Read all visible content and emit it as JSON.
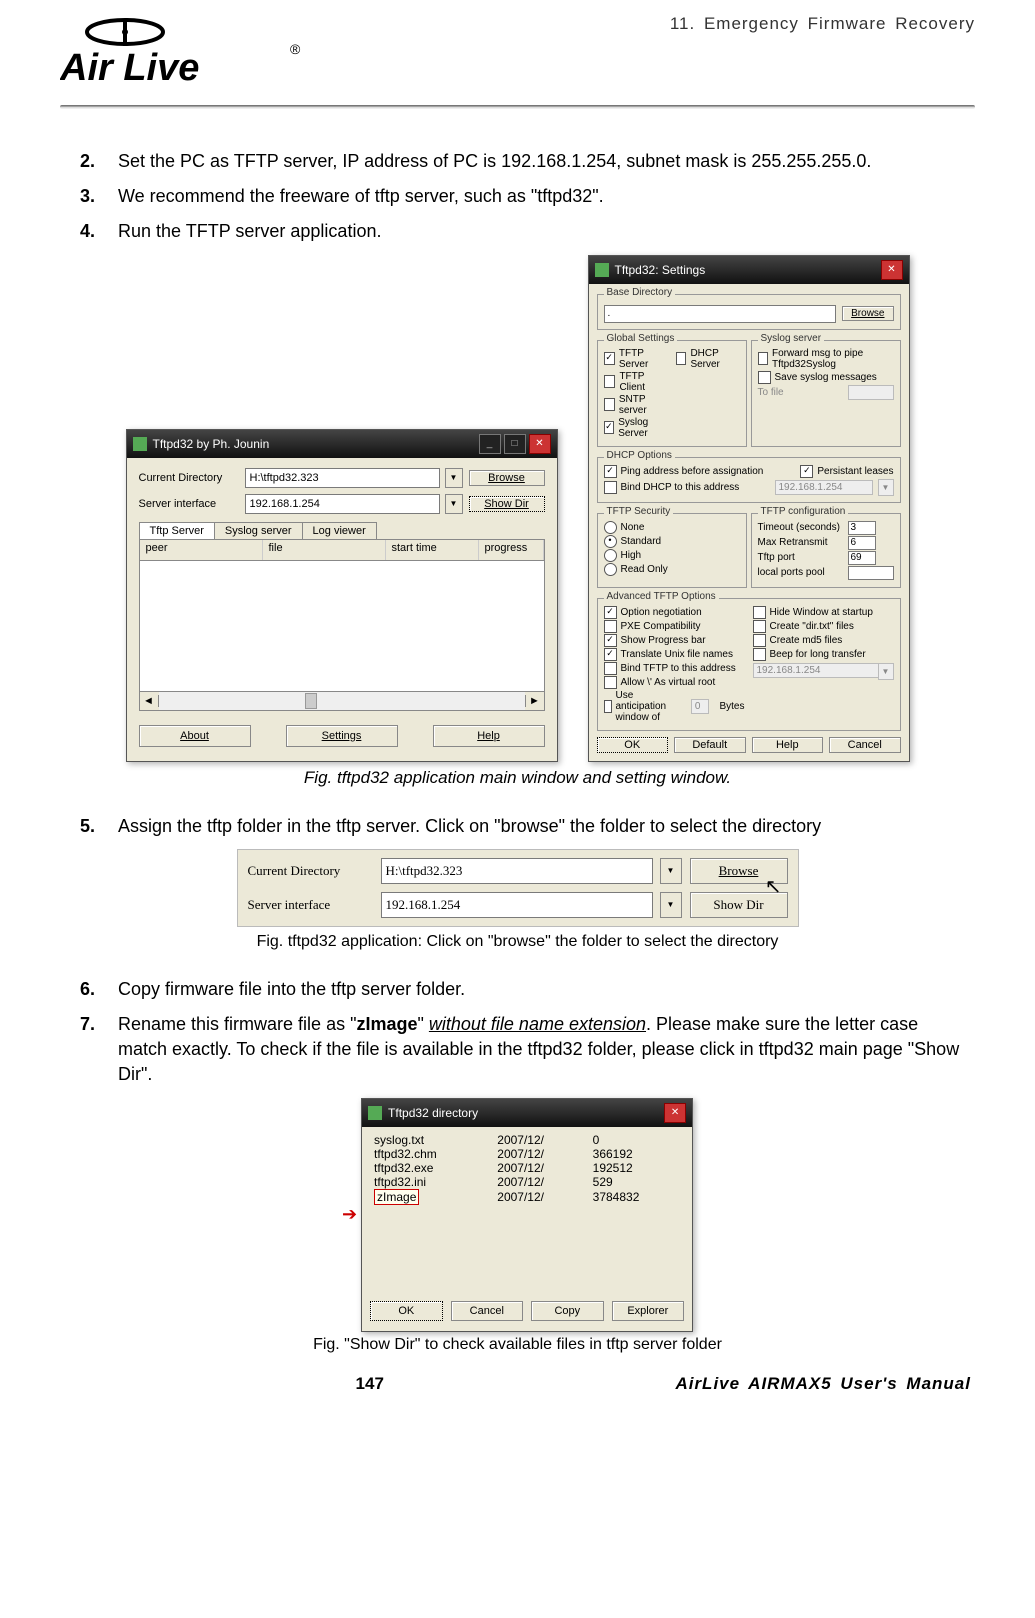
{
  "header": {
    "logo_text": "Air Live",
    "chapter": "11.  Emergency  Firmware  Recovery"
  },
  "steps": {
    "s2_num": "2.",
    "s2_txt": "Set the PC as TFTP server, IP address of PC is 192.168.1.254, subnet mask is 255.255.255.0.",
    "s3_num": "3.",
    "s3_txt": "We recommend the freeware of tftp server, such as \"tftpd32\".",
    "s4_num": "4.",
    "s4_txt": "Run the TFTP server application.",
    "s5_num": "5.",
    "s5_txt": "Assign the tftp folder in the tftp server. Click on \"browse\" the folder to select the directory",
    "s6_num": "6.",
    "s6_txt": "Copy firmware file into the tftp server folder.",
    "s7_num": "7.",
    "s7_pre": "Rename this firmware file as \"",
    "s7_bold": "zImage",
    "s7_mid1": "\" ",
    "s7_ul": "without file name extension",
    "s7_mid2": ".   Please make sure the letter case match exactly.   To check if the file is available in the tftpd32 folder, please click in tftpd32 main page \"Show Dir\"."
  },
  "captions": {
    "c1": "Fig. tftpd32 application main window and setting window.",
    "c2": "Fig. tftpd32 application: Click on \"browse\" the folder to select the directory",
    "c3": "Fig. \"Show Dir\" to check available files in tftp server folder"
  },
  "footer": {
    "page": "147",
    "manual": "AirLive  AIRMAX5  User's  Manual"
  },
  "mainwin": {
    "title": "Tftpd32 by Ph. Jounin",
    "lbl_curdir": "Current Directory",
    "val_curdir": "H:\\tftpd32.323",
    "lbl_iface": "Server interface",
    "val_iface": "192.168.1.254",
    "btn_browse": "Browse",
    "btn_showdir": "Show Dir",
    "tab1": "Tftp Server",
    "tab2": "Syslog server",
    "tab3": "Log viewer",
    "col_peer": "peer",
    "col_file": "file",
    "col_start": "start time",
    "col_prog": "progress",
    "btn_about": "About",
    "btn_settings": "Settings",
    "btn_help": "Help"
  },
  "settings": {
    "title": "Tftpd32: Settings",
    "lbl_basedir": "Base Directory",
    "btn_browse": "Browse",
    "grp_global": "Global Settings",
    "cb_tftpserver": "TFTP Server",
    "cb_tftpclient": "TFTP Client",
    "cb_sntp": "SNTP server",
    "cb_syslog": "Syslog Server",
    "cb_dhcp": "DHCP Server",
    "grp_syslog": "Syslog server",
    "cb_fwd": "Forward msg to pipe Tftpd32Syslog",
    "cb_save": "Save syslog messages",
    "lbl_tofile": "To file",
    "grp_dhcp": "DHCP Options",
    "cb_ping": "Ping address before assignation",
    "cb_persist": "Persistant leases",
    "cb_bind": "Bind DHCP to this address",
    "dhcp_ip": "192.168.1.254",
    "grp_sec": "TFTP Security",
    "r_none": "None",
    "r_std": "Standard",
    "r_high": "High",
    "r_ro": "Read Only",
    "grp_cfg": "TFTP configuration",
    "k_timeout": "Timeout (seconds)",
    "v_timeout": "3",
    "k_retrans": "Max Retransmit",
    "v_retrans": "6",
    "k_port": "Tftp port",
    "v_port": "69",
    "k_pool": "local ports pool",
    "grp_adv": "Advanced TFTP Options",
    "a1": "Option negotiation",
    "a2": "PXE Compatibility",
    "a3": "Show Progress bar",
    "a4": "Translate Unix file names",
    "a5": "Bind TFTP to this address",
    "a6": "Allow \\' As virtual root",
    "a7": "Use anticipation window of",
    "a_bytes": "Bytes",
    "b1": "Hide Window at startup",
    "b2": "Create \"dir.txt\" files",
    "b3": "Create md5 files",
    "b4": "Beep for long transfer",
    "bind_ip": "192.168.1.254",
    "a7_val": "0",
    "btn_ok": "OK",
    "btn_def": "Default",
    "btn_help": "Help",
    "btn_cancel": "Cancel"
  },
  "browsefig": {
    "lbl_curdir": "Current Directory",
    "val_curdir": "H:\\tftpd32.323",
    "lbl_iface": "Server interface",
    "val_iface": "192.168.1.254",
    "btn_browse": "Browse",
    "btn_showdir": "Show Dir",
    "cursor": "↖"
  },
  "dirwin": {
    "title": "Tftpd32 directory",
    "files": [
      {
        "n": "syslog.txt",
        "d": "2007/12/",
        "s": "0"
      },
      {
        "n": "tftpd32.chm",
        "d": "2007/12/",
        "s": "366192"
      },
      {
        "n": "tftpd32.exe",
        "d": "2007/12/",
        "s": "192512"
      },
      {
        "n": "tftpd32.ini",
        "d": "2007/12/",
        "s": "529"
      },
      {
        "n": "zImage",
        "d": "2007/12/",
        "s": "3784832"
      }
    ],
    "btn_ok": "OK",
    "btn_cancel": "Cancel",
    "btn_copy": "Copy",
    "btn_explorer": "Explorer"
  }
}
